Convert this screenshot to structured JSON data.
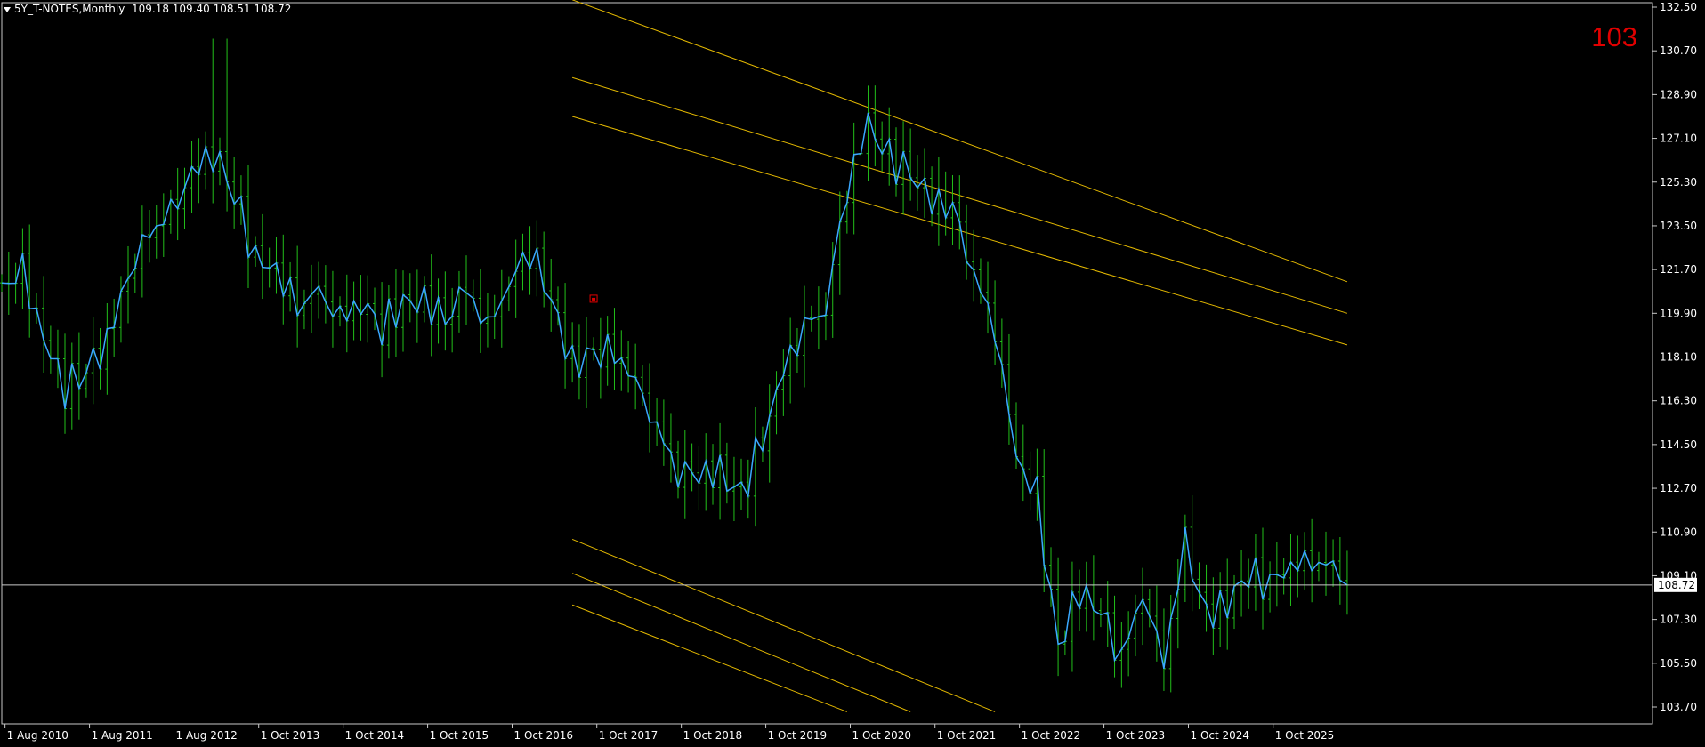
{
  "header": {
    "symbol_timeframe": "5Y_T-NOTES,Monthly",
    "ohlc": "109.18 109.40 108.51 108.72"
  },
  "overlay_number": "103",
  "colors": {
    "background": "#000000",
    "bars": "#22c01a",
    "close_line": "#3aa8ff",
    "channel": "#e3b800",
    "price_line": "#c9c9c9",
    "overlay_number": "#e00000",
    "marker": "#e00000"
  },
  "chart_data": {
    "type": "line",
    "title": "5Y_T-NOTES,Monthly",
    "ylim": [
      103.2,
      133.0
    ],
    "y_ticks": [
      "132.50",
      "130.70",
      "128.90",
      "127.10",
      "125.30",
      "123.50",
      "121.70",
      "119.90",
      "118.10",
      "116.30",
      "114.50",
      "112.70",
      "110.90",
      "109.10",
      "107.30",
      "105.50",
      "103.70"
    ],
    "x_ticks": [
      "1 Aug 2010",
      "1 Aug 2011",
      "1 Aug 2012",
      "1 Oct 2013",
      "1 Oct 2014",
      "1 Oct 2015",
      "1 Oct 2016",
      "1 Oct 2017",
      "1 Oct 2018",
      "1 Oct 2019",
      "1 Oct 2020",
      "1 Oct 2021",
      "1 Oct 2022",
      "1 Oct 2023",
      "1 Oct 2024",
      "1 Oct 2025"
    ],
    "x_start": "2010-01-01",
    "x_end": "2025-12-01",
    "x_range": [
      "2010-01-01",
      "2025-12-01"
    ],
    "current_price": 108.72,
    "series": [
      {
        "kind": "close_line",
        "points": [
          [
            "2010-01-01",
            120.8
          ],
          [
            "2010-04-01",
            121.6
          ],
          [
            "2010-07-01",
            119.0
          ],
          [
            "2010-10-01",
            116.8
          ],
          [
            "2011-01-01",
            117.5
          ],
          [
            "2011-04-01",
            118.9
          ],
          [
            "2011-07-01",
            121.5
          ],
          [
            "2011-10-01",
            123.0
          ],
          [
            "2012-01-01",
            123.9
          ],
          [
            "2012-04-01",
            125.8
          ],
          [
            "2012-07-01",
            126.6
          ],
          [
            "2012-10-01",
            124.8
          ],
          [
            "2013-01-01",
            122.2
          ],
          [
            "2013-04-01",
            121.8
          ],
          [
            "2013-07-01",
            120.0
          ],
          [
            "2013-10-01",
            120.6
          ],
          [
            "2014-01-01",
            119.8
          ],
          [
            "2014-04-01",
            120.5
          ],
          [
            "2014-07-01",
            119.3
          ],
          [
            "2014-10-01",
            120.3
          ],
          [
            "2015-01-01",
            120.5
          ],
          [
            "2015-04-01",
            119.6
          ],
          [
            "2015-07-01",
            120.7
          ],
          [
            "2015-10-01",
            119.3
          ],
          [
            "2016-01-01",
            121.3
          ],
          [
            "2016-04-01",
            122.6
          ],
          [
            "2016-07-01",
            120.4
          ],
          [
            "2016-10-01",
            117.8
          ],
          [
            "2017-01-01",
            118.3
          ],
          [
            "2017-04-01",
            118.1
          ],
          [
            "2017-07-01",
            117.0
          ],
          [
            "2017-10-01",
            115.4
          ],
          [
            "2018-01-01",
            113.5
          ],
          [
            "2018-04-01",
            113.2
          ],
          [
            "2018-07-01",
            113.3
          ],
          [
            "2018-10-01",
            112.5
          ],
          [
            "2019-01-01",
            114.6
          ],
          [
            "2019-04-01",
            117.4
          ],
          [
            "2019-07-01",
            119.5
          ],
          [
            "2019-10-01",
            120.3
          ],
          [
            "2020-01-01",
            125.0
          ],
          [
            "2020-04-01",
            127.6
          ],
          [
            "2020-07-01",
            126.3
          ],
          [
            "2020-10-01",
            125.7
          ],
          [
            "2021-01-01",
            124.4
          ],
          [
            "2021-04-01",
            124.3
          ],
          [
            "2021-07-01",
            121.8
          ],
          [
            "2021-10-01",
            119.3
          ],
          [
            "2022-01-01",
            113.8
          ],
          [
            "2022-04-01",
            112.3
          ],
          [
            "2022-07-01",
            106.2
          ],
          [
            "2022-10-01",
            108.4
          ],
          [
            "2023-01-01",
            107.6
          ],
          [
            "2023-04-01",
            105.9
          ],
          [
            "2023-07-01",
            108.5
          ],
          [
            "2023-10-01",
            105.4
          ],
          [
            "2024-01-01",
            110.3
          ],
          [
            "2024-04-01",
            107.5
          ],
          [
            "2024-07-01",
            108.0
          ],
          [
            "2024-10-01",
            109.1
          ],
          [
            "2025-01-01",
            108.9
          ],
          [
            "2025-04-01",
            109.7
          ],
          [
            "2025-07-01",
            109.6
          ],
          [
            "2025-10-01",
            109.2
          ],
          [
            "2025-12-01",
            108.72
          ]
        ]
      }
    ],
    "channel_lines": [
      {
        "name": "upper-channel-1",
        "from": [
          "2016-10-01",
          132.8
        ],
        "to": [
          "2025-12-01",
          121.2
        ]
      },
      {
        "name": "upper-channel-2",
        "from": [
          "2016-10-01",
          129.6
        ],
        "to": [
          "2025-12-01",
          119.9
        ]
      },
      {
        "name": "upper-channel-3",
        "from": [
          "2016-10-01",
          128.0
        ],
        "to": [
          "2025-12-01",
          118.6
        ]
      },
      {
        "name": "lower-channel-1",
        "from": [
          "2016-10-01",
          110.6
        ],
        "to": [
          "2021-10-01",
          103.5
        ]
      },
      {
        "name": "lower-channel-2",
        "from": [
          "2016-10-01",
          109.2
        ],
        "to": [
          "2020-10-01",
          103.5
        ]
      },
      {
        "name": "lower-channel-3",
        "from": [
          "2016-10-01",
          107.9
        ],
        "to": [
          "2020-01-01",
          103.5
        ]
      }
    ],
    "marker": {
      "date": "2017-01-01",
      "price": 120.5
    }
  }
}
